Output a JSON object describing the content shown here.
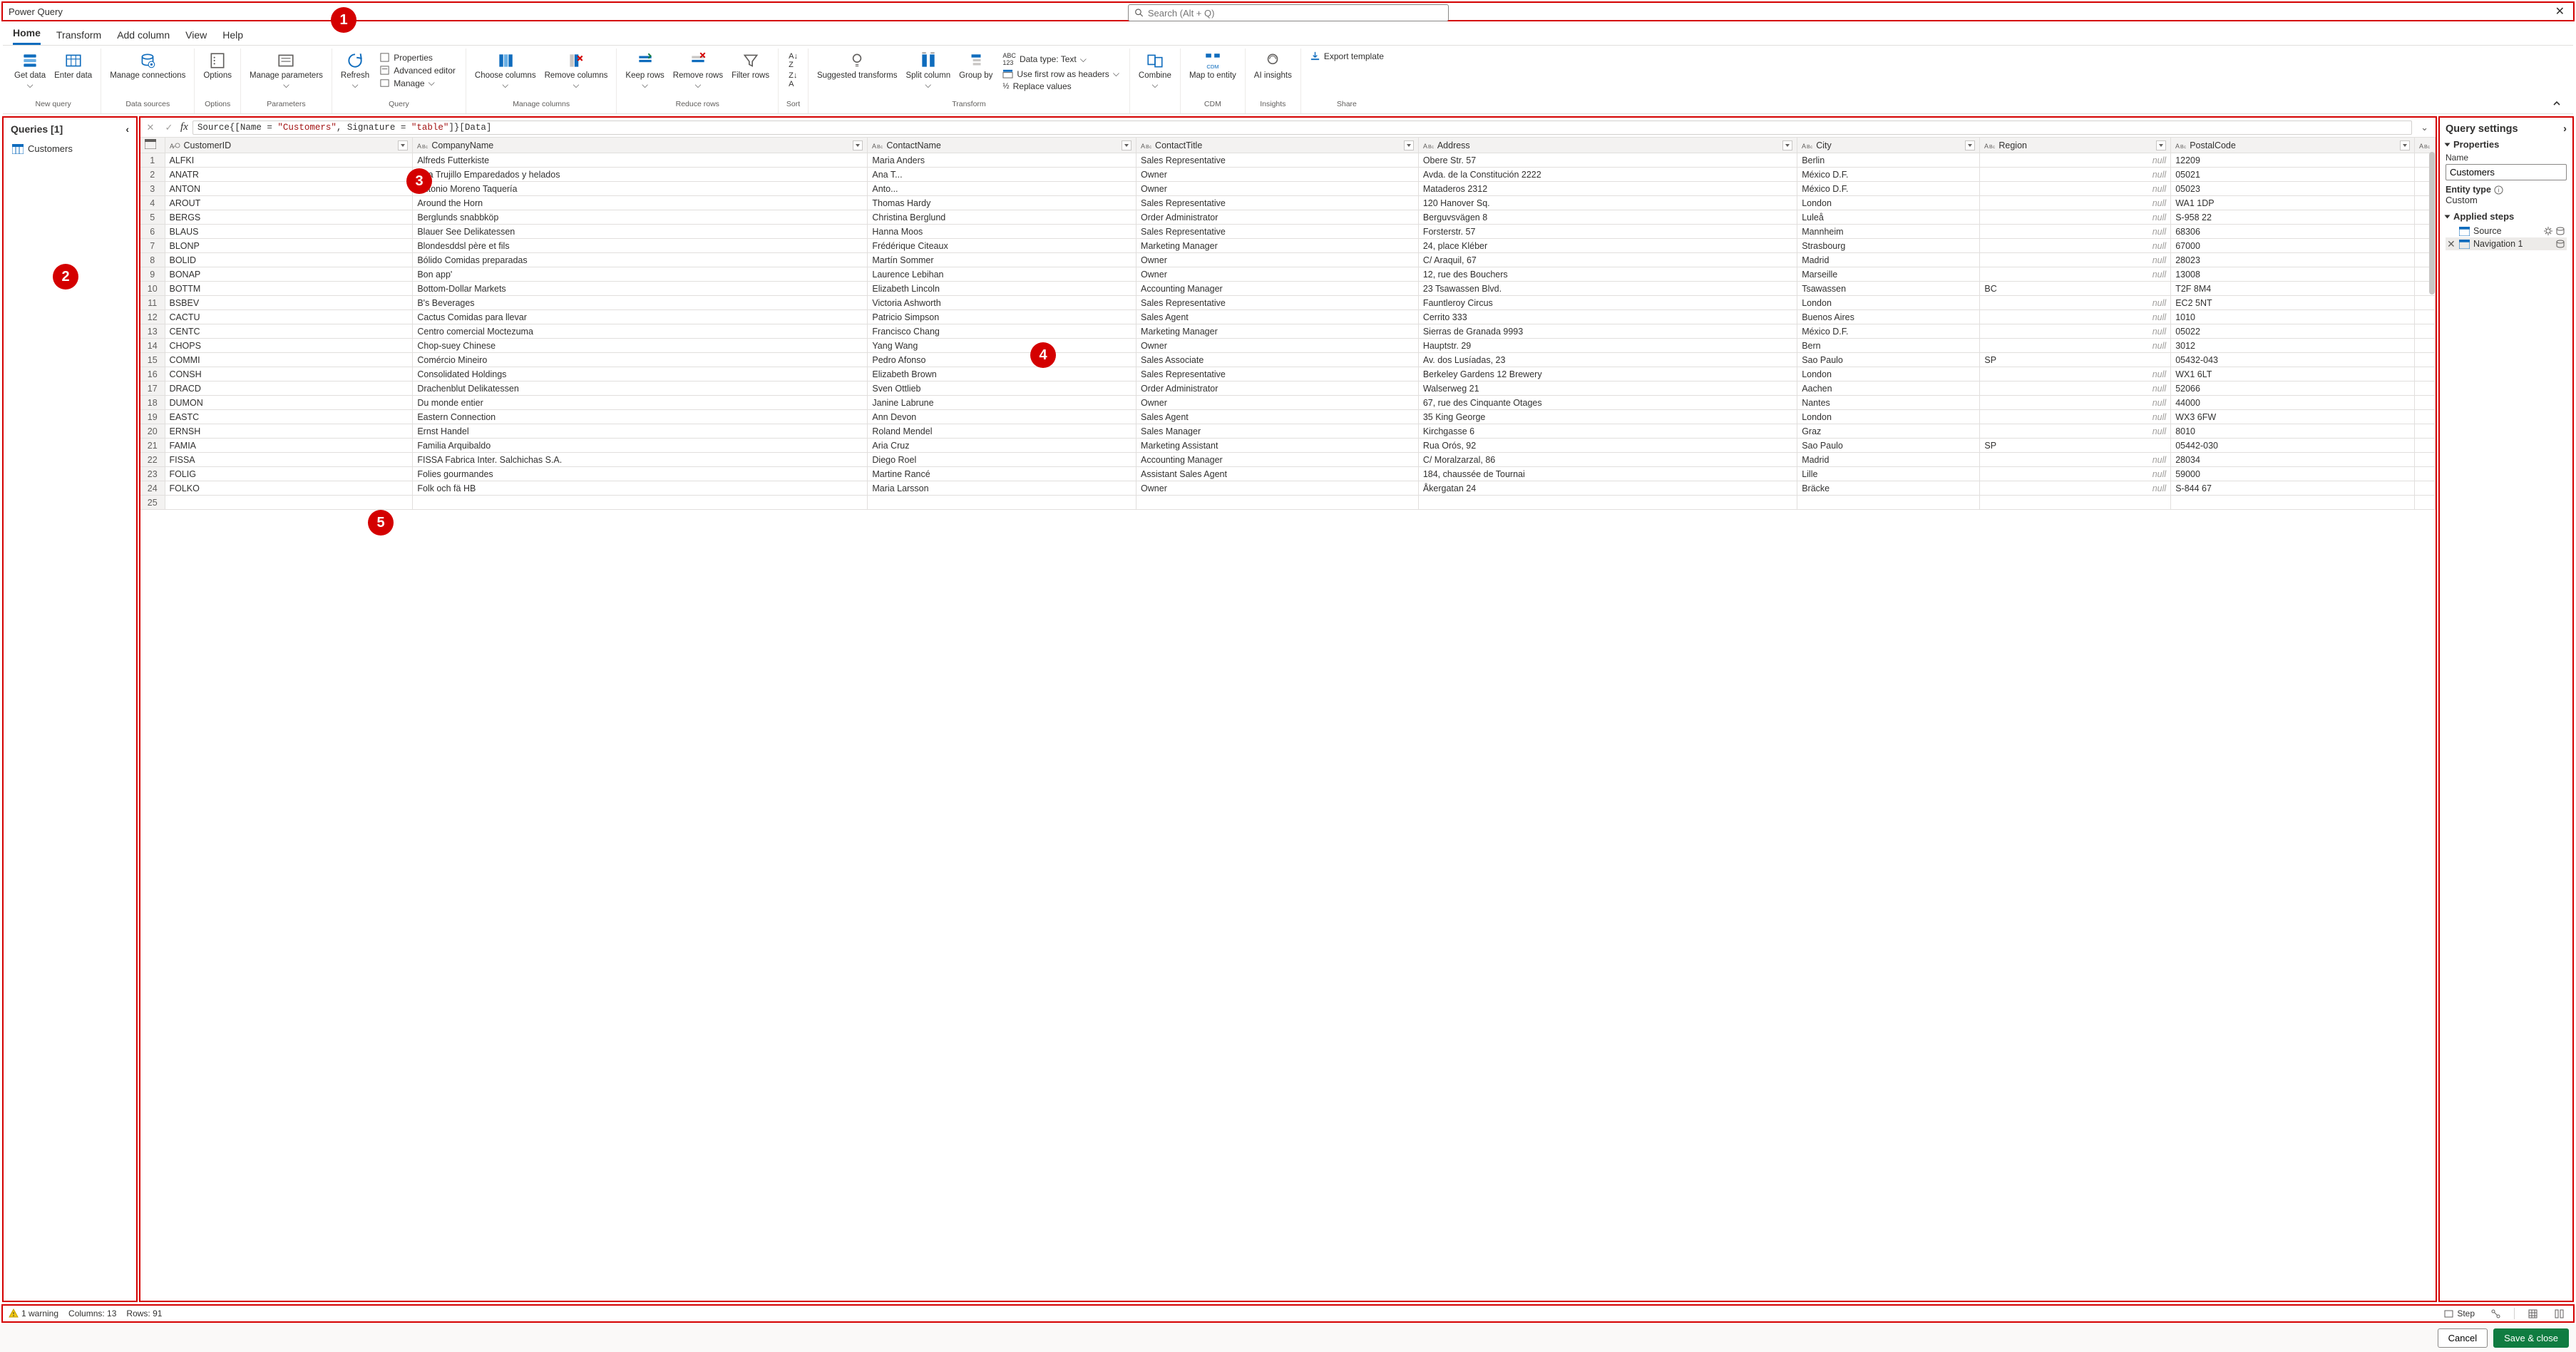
{
  "title": "Power Query",
  "search_placeholder": "Search (Alt + Q)",
  "tabs": [
    "Home",
    "Transform",
    "Add column",
    "View",
    "Help"
  ],
  "ribbon": {
    "new_query": {
      "get_data": "Get data",
      "enter_data": "Enter data",
      "label": "New query"
    },
    "data_sources": {
      "manage_conn": "Manage connections",
      "label": "Data sources"
    },
    "options": {
      "options": "Options",
      "label": "Options"
    },
    "parameters": {
      "manage_params": "Manage parameters",
      "label": "Parameters"
    },
    "query": {
      "refresh": "Refresh",
      "properties": "Properties",
      "adv_editor": "Advanced editor",
      "manage": "Manage",
      "label": "Query"
    },
    "manage_cols": {
      "choose": "Choose columns",
      "remove": "Remove columns",
      "label": "Manage columns"
    },
    "reduce": {
      "keep": "Keep rows",
      "remove": "Remove rows",
      "filter": "Filter rows",
      "label": "Reduce rows"
    },
    "sort": {
      "label": "Sort"
    },
    "transform": {
      "suggested": "Suggested transforms",
      "split": "Split column",
      "group": "Group by",
      "data_type": "Data type: Text",
      "first_row": "Use first row as headers",
      "replace": "Replace values",
      "label": "Transform"
    },
    "combine": {
      "combine": "Combine",
      "label": ""
    },
    "cdm": {
      "map": "Map to entity",
      "label": "CDM"
    },
    "insights": {
      "ai": "AI insights",
      "label": "Insights"
    },
    "share": {
      "export": "Export template",
      "label": "Share"
    }
  },
  "queries_panel": {
    "header": "Queries [1]",
    "items": [
      "Customers"
    ]
  },
  "formula": {
    "pre": "Source{[Name = ",
    "s1": "\"Customers\"",
    "mid": ", Signature = ",
    "s2": "\"table\"",
    "post": "]}[Data]"
  },
  "columns": [
    "CustomerID",
    "CompanyName",
    "ContactName",
    "ContactTitle",
    "Address",
    "City",
    "Region",
    "PostalCode"
  ],
  "col_types": [
    "key",
    "text",
    "text",
    "text",
    "text",
    "text",
    "text",
    "text"
  ],
  "rows": [
    [
      "ALFKI",
      "Alfreds Futterkiste",
      "Maria Anders",
      "Sales Representative",
      "Obere Str. 57",
      "Berlin",
      null,
      "12209"
    ],
    [
      "ANATR",
      "Ana Trujillo Emparedados y helados",
      "Ana T...",
      "Owner",
      "Avda. de la Constitución 2222",
      "México D.F.",
      null,
      "05021"
    ],
    [
      "ANTON",
      "Antonio Moreno Taquería",
      "Anto...",
      "Owner",
      "Mataderos  2312",
      "México D.F.",
      null,
      "05023"
    ],
    [
      "AROUT",
      "Around the Horn",
      "Thomas Hardy",
      "Sales Representative",
      "120 Hanover Sq.",
      "London",
      null,
      "WA1 1DP"
    ],
    [
      "BERGS",
      "Berglunds snabbköp",
      "Christina Berglund",
      "Order Administrator",
      "Berguvsvägen  8",
      "Luleå",
      null,
      "S-958 22"
    ],
    [
      "BLAUS",
      "Blauer See Delikatessen",
      "Hanna Moos",
      "Sales Representative",
      "Forsterstr. 57",
      "Mannheim",
      null,
      "68306"
    ],
    [
      "BLONP",
      "Blondesddsl père et fils",
      "Frédérique Citeaux",
      "Marketing Manager",
      "24, place Kléber",
      "Strasbourg",
      null,
      "67000"
    ],
    [
      "BOLID",
      "Bólido Comidas preparadas",
      "Martín Sommer",
      "Owner",
      "C/ Araquil, 67",
      "Madrid",
      null,
      "28023"
    ],
    [
      "BONAP",
      "Bon app'",
      "Laurence Lebihan",
      "Owner",
      "12, rue des Bouchers",
      "Marseille",
      null,
      "13008"
    ],
    [
      "BOTTM",
      "Bottom-Dollar Markets",
      "Elizabeth Lincoln",
      "Accounting Manager",
      "23 Tsawassen Blvd.",
      "Tsawassen",
      "BC",
      "T2F 8M4"
    ],
    [
      "BSBEV",
      "B's Beverages",
      "Victoria Ashworth",
      "Sales Representative",
      "Fauntleroy Circus",
      "London",
      null,
      "EC2 5NT"
    ],
    [
      "CACTU",
      "Cactus Comidas para llevar",
      "Patricio Simpson",
      "Sales Agent",
      "Cerrito 333",
      "Buenos Aires",
      null,
      "1010"
    ],
    [
      "CENTC",
      "Centro comercial Moctezuma",
      "Francisco Chang",
      "Marketing Manager",
      "Sierras de Granada 9993",
      "México D.F.",
      null,
      "05022"
    ],
    [
      "CHOPS",
      "Chop-suey Chinese",
      "Yang Wang",
      "Owner",
      "Hauptstr. 29",
      "Bern",
      null,
      "3012"
    ],
    [
      "COMMI",
      "Comércio Mineiro",
      "Pedro Afonso",
      "Sales Associate",
      "Av. dos Lusíadas, 23",
      "Sao Paulo",
      "SP",
      "05432-043"
    ],
    [
      "CONSH",
      "Consolidated Holdings",
      "Elizabeth Brown",
      "Sales Representative",
      "Berkeley Gardens 12  Brewery",
      "London",
      null,
      "WX1 6LT"
    ],
    [
      "DRACD",
      "Drachenblut Delikatessen",
      "Sven Ottlieb",
      "Order Administrator",
      "Walserweg 21",
      "Aachen",
      null,
      "52066"
    ],
    [
      "DUMON",
      "Du monde entier",
      "Janine Labrune",
      "Owner",
      "67, rue des Cinquante Otages",
      "Nantes",
      null,
      "44000"
    ],
    [
      "EASTC",
      "Eastern Connection",
      "Ann Devon",
      "Sales Agent",
      "35 King George",
      "London",
      null,
      "WX3 6FW"
    ],
    [
      "ERNSH",
      "Ernst Handel",
      "Roland Mendel",
      "Sales Manager",
      "Kirchgasse 6",
      "Graz",
      null,
      "8010"
    ],
    [
      "FAMIA",
      "Familia Arquibaldo",
      "Aria Cruz",
      "Marketing Assistant",
      "Rua Orós, 92",
      "Sao Paulo",
      "SP",
      "05442-030"
    ],
    [
      "FISSA",
      "FISSA Fabrica Inter. Salchichas S.A.",
      "Diego Roel",
      "Accounting Manager",
      "C/ Moralzarzal, 86",
      "Madrid",
      null,
      "28034"
    ],
    [
      "FOLIG",
      "Folies gourmandes",
      "Martine Rancé",
      "Assistant Sales Agent",
      "184, chaussée de Tournai",
      "Lille",
      null,
      "59000"
    ],
    [
      "FOLKO",
      "Folk och fä HB",
      "Maria Larsson",
      "Owner",
      "Åkergatan 24",
      "Bräcke",
      null,
      "S-844 67"
    ]
  ],
  "settings": {
    "header": "Query settings",
    "properties": "Properties",
    "name_label": "Name",
    "name_value": "Customers",
    "entity_type_label": "Entity type",
    "entity_type_value": "Custom",
    "applied_steps": "Applied steps",
    "steps": [
      "Source",
      "Navigation 1"
    ]
  },
  "status": {
    "warning": "1 warning",
    "cols": "Columns: 13",
    "rows": "Rows: 91",
    "step": "Step"
  },
  "footer": {
    "cancel": "Cancel",
    "save": "Save & close"
  }
}
